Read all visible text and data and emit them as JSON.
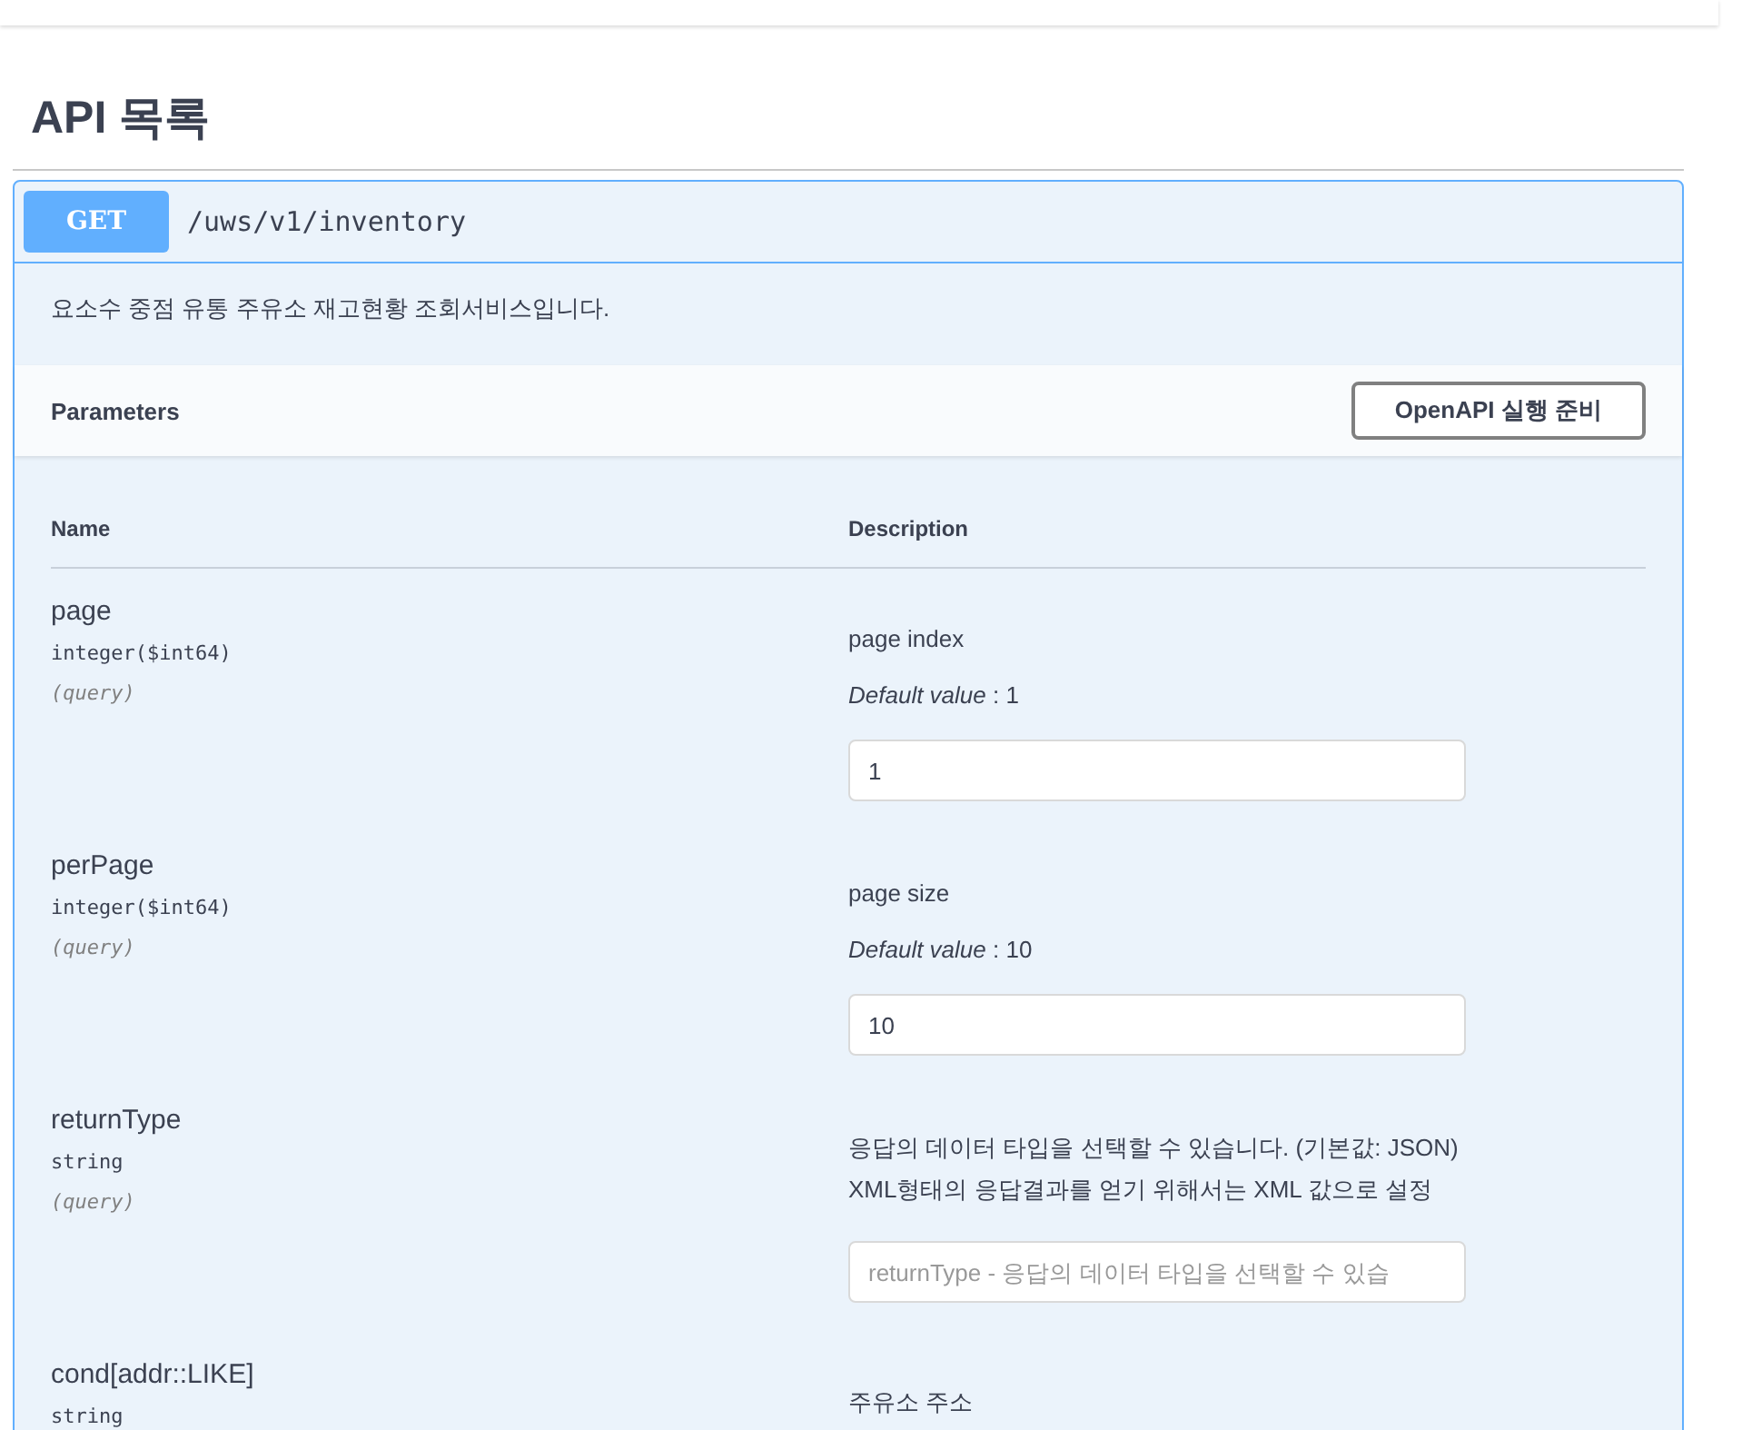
{
  "heading": "API 목록",
  "operation": {
    "method": "GET",
    "path": "/uws/v1/inventory",
    "summary": "요소수 중점 유통 주유소 재고현황 조회서비스입니다.",
    "parameters_title": "Parameters",
    "try_button": "OpenAPI 실행 준비",
    "columns": [
      "Name",
      "Description"
    ],
    "parameters": [
      {
        "name": "page",
        "type": "integer($int64)",
        "in": "(query)",
        "description": [
          "page index"
        ],
        "default": "*Default value* : 1",
        "value": "1"
      },
      {
        "name": "perPage",
        "type": "integer($int64)",
        "in": "(query)",
        "description": [
          "page size"
        ],
        "default": "*Default value* : 10",
        "value": "10"
      },
      {
        "name": "returnType",
        "type": "string",
        "in": "(query)",
        "description": [
          "응답의 데이터 타입을 선택할 수 있습니다. (기본값: JSON)",
          "XML형태의 응답결과를 얻기 위해서는 XML 값으로 설정"
        ],
        "placeholder": "returnType - 응답의 데이터 타입을 선택할 수 있습"
      },
      {
        "name": "cond[addr::LIKE]",
        "type": "string",
        "description": [
          "주유소 주소"
        ]
      }
    ]
  }
}
